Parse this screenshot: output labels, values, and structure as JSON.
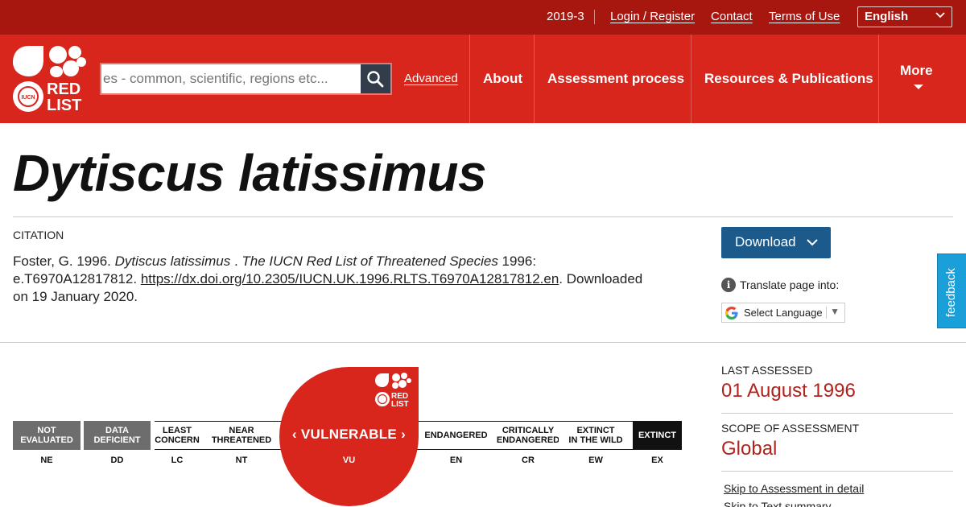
{
  "topbar": {
    "version": "2019-3",
    "login": "Login / Register",
    "contact": "Contact",
    "terms": "Terms of Use",
    "language": "English"
  },
  "nav": {
    "search_placeholder": "Search species - common, scientific, regions etc...",
    "search_visible_text": "es - common, scientific, regions etc...",
    "advanced": "Advanced",
    "about": "About",
    "assessment": "Assessment process",
    "resources": "Resources & Publications",
    "more": "More"
  },
  "species": {
    "title": "Dytiscus latissimus"
  },
  "citation": {
    "label": "CITATION",
    "text_start": "Foster, G. 1996. ",
    "species_italic": "Dytiscus latissimus",
    "text_sep": " . ",
    "journal_italic": "The IUCN Red List of Threatened Species",
    "text_mid": " 1996: e.T6970A12817812. ",
    "doi": "https://dx.doi.org/10.2305/IUCN.UK.1996.RLTS.T6970A12817812.en",
    "text_end": ". Downloaded on 19 January 2020."
  },
  "actions": {
    "download": "Download",
    "translate": "Translate page into:",
    "select_language": "Select Language",
    "feedback": "feedback"
  },
  "scale": {
    "categories": [
      {
        "label_line1": "NOT",
        "label_line2": "EVALUATED",
        "abbr": "NE"
      },
      {
        "label_line1": "DATA",
        "label_line2": "DEFICIENT",
        "abbr": "DD"
      },
      {
        "label_line1": "LEAST",
        "label_line2": "CONCERN",
        "abbr": "LC"
      },
      {
        "label_line1": "NEAR",
        "label_line2": "THREATENED",
        "abbr": "NT"
      },
      {
        "label_line1": "VULNERABLE",
        "label_line2": "",
        "abbr": "VU"
      },
      {
        "label_line1": "ENDANGERED",
        "label_line2": "",
        "abbr": "EN"
      },
      {
        "label_line1": "CRITICALLY",
        "label_line2": "ENDANGERED",
        "abbr": "CR"
      },
      {
        "label_line1": "EXTINCT",
        "label_line2": "IN THE WILD",
        "abbr": "EW"
      },
      {
        "label_line1": "EXTINCT",
        "label_line2": "",
        "abbr": "EX"
      }
    ],
    "current": "VULNERABLE",
    "current_abbr": "VU",
    "logo_text_1": "RED",
    "logo_text_2": "LIST",
    "logo_badge": "IUCN"
  },
  "assessment": {
    "last_assessed_label": "LAST ASSESSED",
    "last_assessed": "01 August 1996",
    "scope_label": "SCOPE OF ASSESSMENT",
    "scope": "Global",
    "skip_detail": "Skip to Assessment in detail",
    "skip_text": "Skip to Text summary"
  },
  "colors": {
    "topbar": "#a8170f",
    "nav": "#d8261d",
    "download": "#1c5a8c",
    "feedback": "#1a9fd9",
    "accent_text": "#b0221a"
  }
}
